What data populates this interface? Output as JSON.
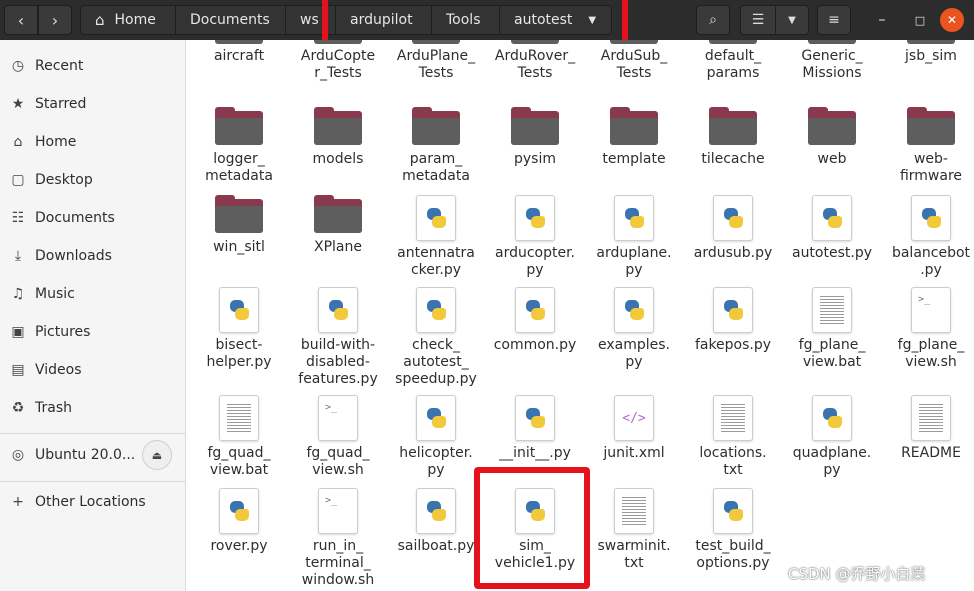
{
  "header": {
    "breadcrumbs": [
      "Home",
      "Documents",
      "ws",
      "ardupilot",
      "Tools",
      "autotest"
    ],
    "icons": {
      "back": "chevron-left-icon",
      "forward": "chevron-right-icon",
      "search": "search-icon",
      "view": "list-view-icon",
      "menu": "hamburger-menu-icon"
    }
  },
  "sidebar": {
    "items": [
      {
        "label": "Recent",
        "icon": "clock-icon"
      },
      {
        "label": "Starred",
        "icon": "star-icon"
      },
      {
        "label": "Home",
        "icon": "home-icon"
      },
      {
        "label": "Desktop",
        "icon": "desktop-icon"
      },
      {
        "label": "Documents",
        "icon": "document-icon"
      },
      {
        "label": "Downloads",
        "icon": "download-icon"
      },
      {
        "label": "Music",
        "icon": "music-icon"
      },
      {
        "label": "Pictures",
        "icon": "picture-icon"
      },
      {
        "label": "Videos",
        "icon": "video-icon"
      },
      {
        "label": "Trash",
        "icon": "trash-icon"
      }
    ],
    "device": {
      "label": "Ubuntu 20.0...",
      "icon": "disk-icon"
    },
    "other": {
      "label": "Other Locations",
      "icon": "plus-icon"
    }
  },
  "files": [
    {
      "name": "aircraft",
      "type": "folder"
    },
    {
      "name": "ArduCopter_Tests",
      "type": "folder"
    },
    {
      "name": "ArduPlane_Tests",
      "type": "folder"
    },
    {
      "name": "ArduRover_Tests",
      "type": "folder"
    },
    {
      "name": "ArduSub_Tests",
      "type": "folder"
    },
    {
      "name": "default_params",
      "type": "folder"
    },
    {
      "name": "Generic_Missions",
      "type": "folder"
    },
    {
      "name": "jsb_sim",
      "type": "folder"
    },
    {
      "name": "logger_metadata",
      "type": "folder"
    },
    {
      "name": "models",
      "type": "folder"
    },
    {
      "name": "param_metadata",
      "type": "folder"
    },
    {
      "name": "pysim",
      "type": "folder"
    },
    {
      "name": "template",
      "type": "folder"
    },
    {
      "name": "tilecache",
      "type": "folder"
    },
    {
      "name": "web",
      "type": "folder"
    },
    {
      "name": "web-firmware",
      "type": "folder"
    },
    {
      "name": "win_sitl",
      "type": "folder"
    },
    {
      "name": "XPlane",
      "type": "folder"
    },
    {
      "name": "antennatracker.py",
      "type": "python"
    },
    {
      "name": "arducopter.py",
      "type": "python"
    },
    {
      "name": "arduplane.py",
      "type": "python"
    },
    {
      "name": "ardusub.py",
      "type": "python"
    },
    {
      "name": "autotest.py",
      "type": "python"
    },
    {
      "name": "balancebot.py",
      "type": "python"
    },
    {
      "name": "bisect-helper.py",
      "type": "python"
    },
    {
      "name": "build-with-disabled-features.py",
      "type": "python"
    },
    {
      "name": "check_autotest_speedup.py",
      "type": "python"
    },
    {
      "name": "common.py",
      "type": "python"
    },
    {
      "name": "examples.py",
      "type": "python"
    },
    {
      "name": "fakepos.py",
      "type": "python"
    },
    {
      "name": "fg_plane_view.bat",
      "type": "text"
    },
    {
      "name": "fg_plane_view.sh",
      "type": "shell"
    },
    {
      "name": "fg_quad_view.bat",
      "type": "text"
    },
    {
      "name": "fg_quad_view.sh",
      "type": "shell"
    },
    {
      "name": "helicopter.py",
      "type": "python"
    },
    {
      "name": "__init__.py",
      "type": "python"
    },
    {
      "name": "junit.xml",
      "type": "xml"
    },
    {
      "name": "locations.txt",
      "type": "text"
    },
    {
      "name": "quadplane.py",
      "type": "python"
    },
    {
      "name": "README",
      "type": "text"
    },
    {
      "name": "rover.py",
      "type": "python"
    },
    {
      "name": "run_in_terminal_window.sh",
      "type": "shell"
    },
    {
      "name": "sailboat.py",
      "type": "python"
    },
    {
      "name": "sim_vehicle1.py",
      "type": "python"
    },
    {
      "name": "swarminit.txt",
      "type": "text"
    },
    {
      "name": "test_build_options.py",
      "type": "python"
    }
  ],
  "labels": {
    "aircraft": [
      "aircraft"
    ],
    "ArduCopter_Tests": [
      "ArduCopte",
      "r_Tests"
    ],
    "ArduPlane_Tests": [
      "ArduPlane_",
      "Tests"
    ],
    "ArduRover_Tests": [
      "ArduRover_",
      "Tests"
    ],
    "ArduSub_Tests": [
      "ArduSub_",
      "Tests"
    ],
    "default_params": [
      "default_",
      "params"
    ],
    "Generic_Missions": [
      "Generic_",
      "Missions"
    ],
    "jsb_sim": [
      "jsb_sim"
    ],
    "logger_metadata": [
      "logger_",
      "metadata"
    ],
    "models": [
      "models"
    ],
    "param_metadata": [
      "param_",
      "metadata"
    ],
    "pysim": [
      "pysim"
    ],
    "template": [
      "template"
    ],
    "tilecache": [
      "tilecache"
    ],
    "web": [
      "web"
    ],
    "web-firmware": [
      "web-",
      "firmware"
    ],
    "win_sitl": [
      "win_sitl"
    ],
    "XPlane": [
      "XPlane"
    ],
    "antennatracker.py": [
      "antennatra",
      "cker.py"
    ],
    "arducopter.py": [
      "arducopter.",
      "py"
    ],
    "arduplane.py": [
      "arduplane.",
      "py"
    ],
    "ardusub.py": [
      "ardusub.py"
    ],
    "autotest.py": [
      "autotest.py"
    ],
    "balancebot.py": [
      "balancebot",
      ".py"
    ],
    "bisect-helper.py": [
      "bisect-",
      "helper.py"
    ],
    "build-with-disabled-features.py": [
      "build-with-",
      "disabled-",
      "features.py"
    ],
    "check_autotest_speedup.py": [
      "check_",
      "autotest_",
      "speedup.py"
    ],
    "common.py": [
      "common.py"
    ],
    "examples.py": [
      "examples.",
      "py"
    ],
    "fakepos.py": [
      "fakepos.py"
    ],
    "fg_plane_view.bat": [
      "fg_plane_",
      "view.bat"
    ],
    "fg_plane_view.sh": [
      "fg_plane_",
      "view.sh"
    ],
    "fg_quad_view.bat": [
      "fg_quad_",
      "view.bat"
    ],
    "fg_quad_view.sh": [
      "fg_quad_",
      "view.sh"
    ],
    "helicopter.py": [
      "helicopter.",
      "py"
    ],
    "__init__.py": [
      "__init__.py"
    ],
    "junit.xml": [
      "junit.xml"
    ],
    "locations.txt": [
      "locations.",
      "txt"
    ],
    "quadplane.py": [
      "quadplane.",
      "py"
    ],
    "README": [
      "README"
    ],
    "rover.py": [
      "rover.py"
    ],
    "run_in_terminal_window.sh": [
      "run_in_",
      "terminal_",
      "window.sh"
    ],
    "sailboat.py": [
      "sailboat.py"
    ],
    "sim_vehicle1.py": [
      "sim_",
      "vehicle1.py"
    ],
    "swarminit.txt": [
      "swarminit.",
      "txt"
    ],
    "test_build_options.py": [
      "test_build_",
      "options.py"
    ]
  },
  "watermark": "CSDN @乔野小白菜",
  "colors": {
    "highlight": "#e4121b",
    "folder_tab": "#8a3a4f",
    "folder_body": "#5e5e5e",
    "header_bg": "#2c2c2c"
  }
}
